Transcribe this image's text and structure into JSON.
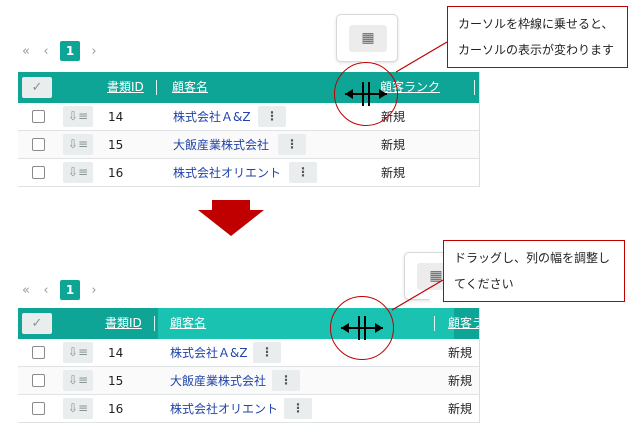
{
  "pager": {
    "first_glyph": "«",
    "prev_glyph": "‹",
    "page": "1",
    "next_glyph": "›"
  },
  "grid": {
    "columns": {
      "doc_id": "書類ID",
      "customer": "顧客名",
      "rank": "顧客ランク",
      "rank_cut": "顧客ラ"
    },
    "rows": [
      {
        "id": "14",
        "customer": "株式会社Ａ&Z",
        "rank": "新規"
      },
      {
        "id": "15",
        "customer": "大飯産業株式会社",
        "rank": "新規"
      },
      {
        "id": "16",
        "customer": "株式会社オリエント",
        "rank": "新規"
      }
    ],
    "check_glyph": "✓",
    "doc_icon": "doc-list-icon",
    "more_glyph": "⋮",
    "table_icon": "table-icon"
  },
  "callouts": {
    "top_line1": "カーソルを枠線に乗せると、",
    "top_line2": "カーソルの表示が変わります",
    "bottom_line1": "ドラッグし、列の幅を調整し",
    "bottom_line2": "てください"
  },
  "colors": {
    "header": "#0ea596",
    "header_highlight": "#19c2b1",
    "marker": "#c00000",
    "arrow": "#c00000",
    "link": "#2244aa"
  }
}
